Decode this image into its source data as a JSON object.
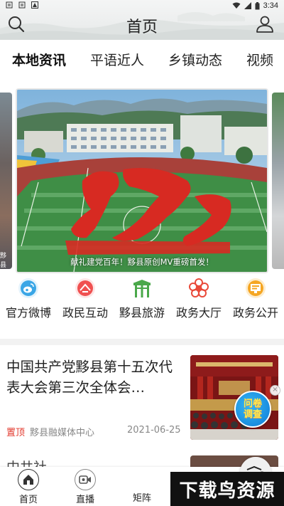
{
  "status_bar": {
    "time": "3:34",
    "left_icons": [
      "sim-icon",
      "sim-icon",
      "alert-icon"
    ],
    "right_icons": [
      "wifi-icon",
      "signal-icon",
      "battery-icon"
    ]
  },
  "header": {
    "title": "首页",
    "left_icon": "search-icon",
    "right_icon": "user-icon"
  },
  "tabs": [
    {
      "label": "本地资讯",
      "active": true
    },
    {
      "label": "平语近人",
      "active": false
    },
    {
      "label": "乡镇动态",
      "active": false
    },
    {
      "label": "视频",
      "active": false
    }
  ],
  "carousel": {
    "caption": "献礼建党百年！黟县原创MV重磅首发！",
    "left_peek_text": "黟县"
  },
  "quick_links": [
    {
      "label": "官方微博",
      "icon": "weibo-icon",
      "color": "#3aa6e6"
    },
    {
      "label": "政民互动",
      "icon": "chat-icon",
      "color": "#f05050"
    },
    {
      "label": "黟县旅游",
      "icon": "archway-icon",
      "color": "#4aa84a"
    },
    {
      "label": "政务大厅",
      "icon": "flower-icon",
      "color": "#e94a3a"
    },
    {
      "label": "政务公开",
      "icon": "notice-board-icon",
      "color": "#f5a623"
    }
  ],
  "article": {
    "title": "中国共产党黟县第十五次代表大会第三次全体会…",
    "pin_label": "置顶",
    "source": "黟县融媒体中心",
    "date": "2021-06-25"
  },
  "float_badge": {
    "line1": "问卷",
    "line2": "调查",
    "close": "×"
  },
  "next_article_peek": "中共社…",
  "bottom_nav": [
    {
      "label": "首页",
      "icon": "home-icon",
      "active": true
    },
    {
      "label": "直播",
      "icon": "video-icon",
      "active": false
    },
    {
      "label": "矩阵",
      "icon": "matrix-icon",
      "active": false
    },
    {
      "label": "",
      "icon": "",
      "active": false
    },
    {
      "label": "",
      "icon": "",
      "active": false
    }
  ],
  "watermark": "下载鸟资源"
}
